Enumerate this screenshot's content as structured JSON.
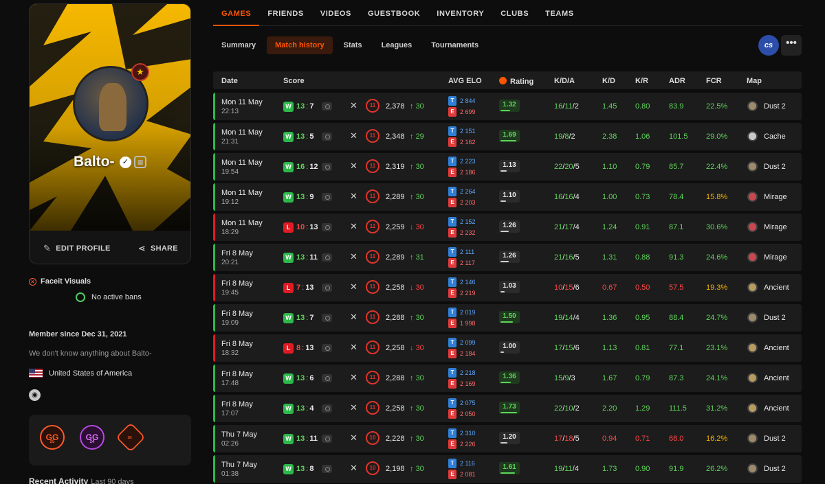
{
  "profile": {
    "name": "Balto-",
    "edit_label": "EDIT PROFILE",
    "share_label": "SHARE",
    "faceit_visuals": "Faceit Visuals",
    "bans": "No active bans",
    "member_since": "Member since Dec 31, 2021",
    "about": "We don't know anything about Balto-",
    "country": "United States of America",
    "badges": [
      {
        "text": "GG",
        "sub": "25"
      },
      {
        "text": "GG",
        "sub": "24"
      },
      {
        "text": "",
        "sub": "1K"
      }
    ],
    "recent_activity": "Recent Activity",
    "recent_range": "Last 90 days"
  },
  "nav": [
    "GAMES",
    "FRIENDS",
    "VIDEOS",
    "GUESTBOOK",
    "INVENTORY",
    "CLUBS",
    "TEAMS"
  ],
  "subnav": [
    "Summary",
    "Match history",
    "Stats",
    "Leagues",
    "Tournaments"
  ],
  "game_logo": "cs",
  "more_glyph": "•••",
  "columns": {
    "date": "Date",
    "score": "Score",
    "avg_elo": "AVG ELO",
    "rating": "Rating",
    "kda": "K/D/A",
    "kd": "K/D",
    "kr": "K/R",
    "adr": "ADR",
    "fcr": "FCR",
    "map": "Map"
  },
  "colors": {
    "win": "#2db84b",
    "loss": "#e01b24",
    "accent": "#ff5500",
    "team_t": "#2f7fd6",
    "team_e": "#e03a3a"
  },
  "matches": [
    {
      "d1": "Mon 11 May",
      "d2": "22:13",
      "res": "W",
      "s1": "13",
      "s2": "7",
      "lvl": "11",
      "elo": "2,378",
      "dir": "up",
      "delta": "30",
      "t": "2 844",
      "e": "2 699",
      "rating": "1.32",
      "k": "16",
      "dd": "11",
      "a": "2",
      "kd": "1.45",
      "kr": "0.80",
      "adr": "83.9",
      "fcr": "22.5%",
      "map": "Dust 2",
      "kc": "g",
      "fc": "g"
    },
    {
      "d1": "Mon 11 May",
      "d2": "21:31",
      "res": "W",
      "s1": "13",
      "s2": "5",
      "lvl": "11",
      "elo": "2,348",
      "dir": "up",
      "delta": "29",
      "t": "2 151",
      "e": "2 162",
      "rating": "1.69",
      "k": "19",
      "dd": "8",
      "a": "2",
      "kd": "2.38",
      "kr": "1.06",
      "adr": "101.5",
      "fcr": "29.0%",
      "map": "Cache",
      "kc": "g",
      "fc": "g"
    },
    {
      "d1": "Mon 11 May",
      "d2": "19:54",
      "res": "W",
      "s1": "16",
      "s2": "12",
      "lvl": "11",
      "elo": "2,319",
      "dir": "up",
      "delta": "30",
      "t": "2 223",
      "e": "2 186",
      "rating": "1.13",
      "k": "22",
      "dd": "20",
      "a": "5",
      "kd": "1.10",
      "kr": "0.79",
      "adr": "85.7",
      "fcr": "22.4%",
      "map": "Dust 2",
      "kc": "g",
      "fc": "g"
    },
    {
      "d1": "Mon 11 May",
      "d2": "19:12",
      "res": "W",
      "s1": "13",
      "s2": "9",
      "lvl": "11",
      "elo": "2,289",
      "dir": "up",
      "delta": "30",
      "t": "2 264",
      "e": "2 203",
      "rating": "1.10",
      "k": "16",
      "dd": "16",
      "a": "4",
      "kd": "1.00",
      "kr": "0.73",
      "adr": "78.4",
      "fcr": "15.8%",
      "map": "Mirage",
      "kc": "g",
      "fc": "y"
    },
    {
      "d1": "Mon 11 May",
      "d2": "18:29",
      "res": "L",
      "s1": "10",
      "s2": "13",
      "lvl": "11",
      "elo": "2,259",
      "dir": "down",
      "delta": "30",
      "t": "2 152",
      "e": "2 232",
      "rating": "1.26",
      "k": "21",
      "dd": "17",
      "a": "4",
      "kd": "1.24",
      "kr": "0.91",
      "adr": "87.1",
      "fcr": "30.6%",
      "map": "Mirage",
      "kc": "g",
      "fc": "g"
    },
    {
      "d1": "Fri 8 May",
      "d2": "20:21",
      "res": "W",
      "s1": "13",
      "s2": "11",
      "lvl": "11",
      "elo": "2,289",
      "dir": "up",
      "delta": "31",
      "t": "2 111",
      "e": "2 117",
      "rating": "1.26",
      "k": "21",
      "dd": "16",
      "a": "5",
      "kd": "1.31",
      "kr": "0.88",
      "adr": "91.3",
      "fcr": "24.6%",
      "map": "Mirage",
      "kc": "g",
      "fc": "g"
    },
    {
      "d1": "Fri 8 May",
      "d2": "19:45",
      "res": "L",
      "s1": "7",
      "s2": "13",
      "lvl": "11",
      "elo": "2,258",
      "dir": "down",
      "delta": "30",
      "t": "2 146",
      "e": "2 219",
      "rating": "1.03",
      "k": "10",
      "dd": "15",
      "a": "6",
      "kd": "0.67",
      "kr": "0.50",
      "adr": "57.5",
      "fcr": "19.3%",
      "map": "Ancient",
      "kc": "r",
      "fc": "y"
    },
    {
      "d1": "Fri 8 May",
      "d2": "19:09",
      "res": "W",
      "s1": "13",
      "s2": "7",
      "lvl": "11",
      "elo": "2,288",
      "dir": "up",
      "delta": "30",
      "t": "2 019",
      "e": "1 998",
      "rating": "1.50",
      "k": "19",
      "dd": "14",
      "a": "4",
      "kd": "1.36",
      "kr": "0.95",
      "adr": "88.4",
      "fcr": "24.7%",
      "map": "Dust 2",
      "kc": "g",
      "fc": "g"
    },
    {
      "d1": "Fri 8 May",
      "d2": "18:32",
      "res": "L",
      "s1": "8",
      "s2": "13",
      "lvl": "11",
      "elo": "2,258",
      "dir": "down",
      "delta": "30",
      "t": "2 099",
      "e": "2 184",
      "rating": "1.00",
      "k": "17",
      "dd": "15",
      "a": "6",
      "kd": "1.13",
      "kr": "0.81",
      "adr": "77.1",
      "fcr": "23.1%",
      "map": "Ancient",
      "kc": "g",
      "fc": "g"
    },
    {
      "d1": "Fri 8 May",
      "d2": "17:48",
      "res": "W",
      "s1": "13",
      "s2": "6",
      "lvl": "11",
      "elo": "2,288",
      "dir": "up",
      "delta": "30",
      "t": "2 218",
      "e": "2 169",
      "rating": "1.36",
      "k": "15",
      "dd": "9",
      "a": "3",
      "kd": "1.67",
      "kr": "0.79",
      "adr": "87.3",
      "fcr": "24.1%",
      "map": "Ancient",
      "kc": "g",
      "fc": "g"
    },
    {
      "d1": "Fri 8 May",
      "d2": "17:07",
      "res": "W",
      "s1": "13",
      "s2": "4",
      "lvl": "11",
      "elo": "2,258",
      "dir": "up",
      "delta": "30",
      "t": "2 075",
      "e": "2 050",
      "rating": "1.73",
      "k": "22",
      "dd": "10",
      "a": "2",
      "kd": "2.20",
      "kr": "1.29",
      "adr": "111.5",
      "fcr": "31.2%",
      "map": "Ancient",
      "kc": "g",
      "fc": "g"
    },
    {
      "d1": "Thu 7 May",
      "d2": "02:26",
      "res": "W",
      "s1": "13",
      "s2": "11",
      "lvl": "10",
      "elo": "2,228",
      "dir": "up",
      "delta": "30",
      "t": "2 310",
      "e": "2 226",
      "rating": "1.20",
      "k": "17",
      "dd": "18",
      "a": "5",
      "kd": "0.94",
      "kr": "0.71",
      "adr": "68.0",
      "fcr": "16.2%",
      "map": "Dust 2",
      "kc": "r",
      "fc": "y"
    },
    {
      "d1": "Thu 7 May",
      "d2": "01:38",
      "res": "W",
      "s1": "13",
      "s2": "8",
      "lvl": "10",
      "elo": "2,198",
      "dir": "up",
      "delta": "30",
      "t": "2 116",
      "e": "2 081",
      "rating": "1.61",
      "k": "19",
      "dd": "11",
      "a": "4",
      "kd": "1.73",
      "kr": "0.90",
      "adr": "91.9",
      "fcr": "26.2%",
      "map": "Dust 2",
      "kc": "g",
      "fc": "g"
    }
  ]
}
